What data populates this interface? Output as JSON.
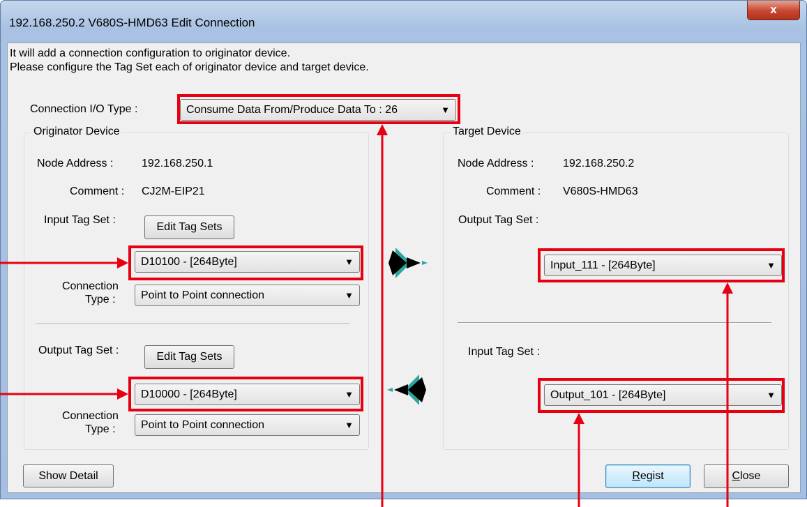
{
  "window": {
    "title": "192.168.250.2 V680S-HMD63 Edit Connection",
    "close_glyph": "x"
  },
  "intro": {
    "line1": "It will add a connection configuration to originator device.",
    "line2": "Please configure the Tag Set each of originator device and target device."
  },
  "connection_io_type": {
    "label": "Connection I/O Type :",
    "value": "Consume Data From/Produce Data To : 26"
  },
  "originator": {
    "legend": "Originator Device",
    "node_address_label": "Node Address :",
    "node_address": "192.168.250.1",
    "comment_label": "Comment :",
    "comment": "CJ2M-EIP21",
    "input_tag_set_label": "Input Tag Set :",
    "input_edit_button": "Edit Tag Sets",
    "input_tag_value": "D10100 - [264Byte]",
    "connection_type_label_1": "Connection",
    "connection_type_label_2": "Type :",
    "input_connection_type": "Point to Point connection",
    "output_tag_set_label": "Output Tag Set :",
    "output_edit_button": "Edit Tag Sets",
    "output_tag_value": "D10000 - [264Byte]",
    "output_connection_type": "Point to Point connection"
  },
  "target": {
    "legend": "Target Device",
    "node_address_label": "Node Address :",
    "node_address": "192.168.250.2",
    "comment_label": "Comment :",
    "comment": "V680S-HMD63",
    "output_tag_set_label": "Output Tag Set :",
    "output_tag_value": "Input_111 - [264Byte]",
    "input_tag_set_label": "Input Tag Set :",
    "input_tag_value": "Output_101 - [264Byte]"
  },
  "buttons": {
    "show_detail": "Show Detail",
    "regist_mnemonic": "R",
    "regist_rest": "egist",
    "close_mnemonic": "C",
    "close_rest": "lose"
  },
  "colors": {
    "annotation_red": "#e60012",
    "arrow_teal": "#2aa7a3"
  },
  "icons": {
    "arrow_right": "data-flow-right-icon",
    "arrow_left": "data-flow-left-icon"
  }
}
